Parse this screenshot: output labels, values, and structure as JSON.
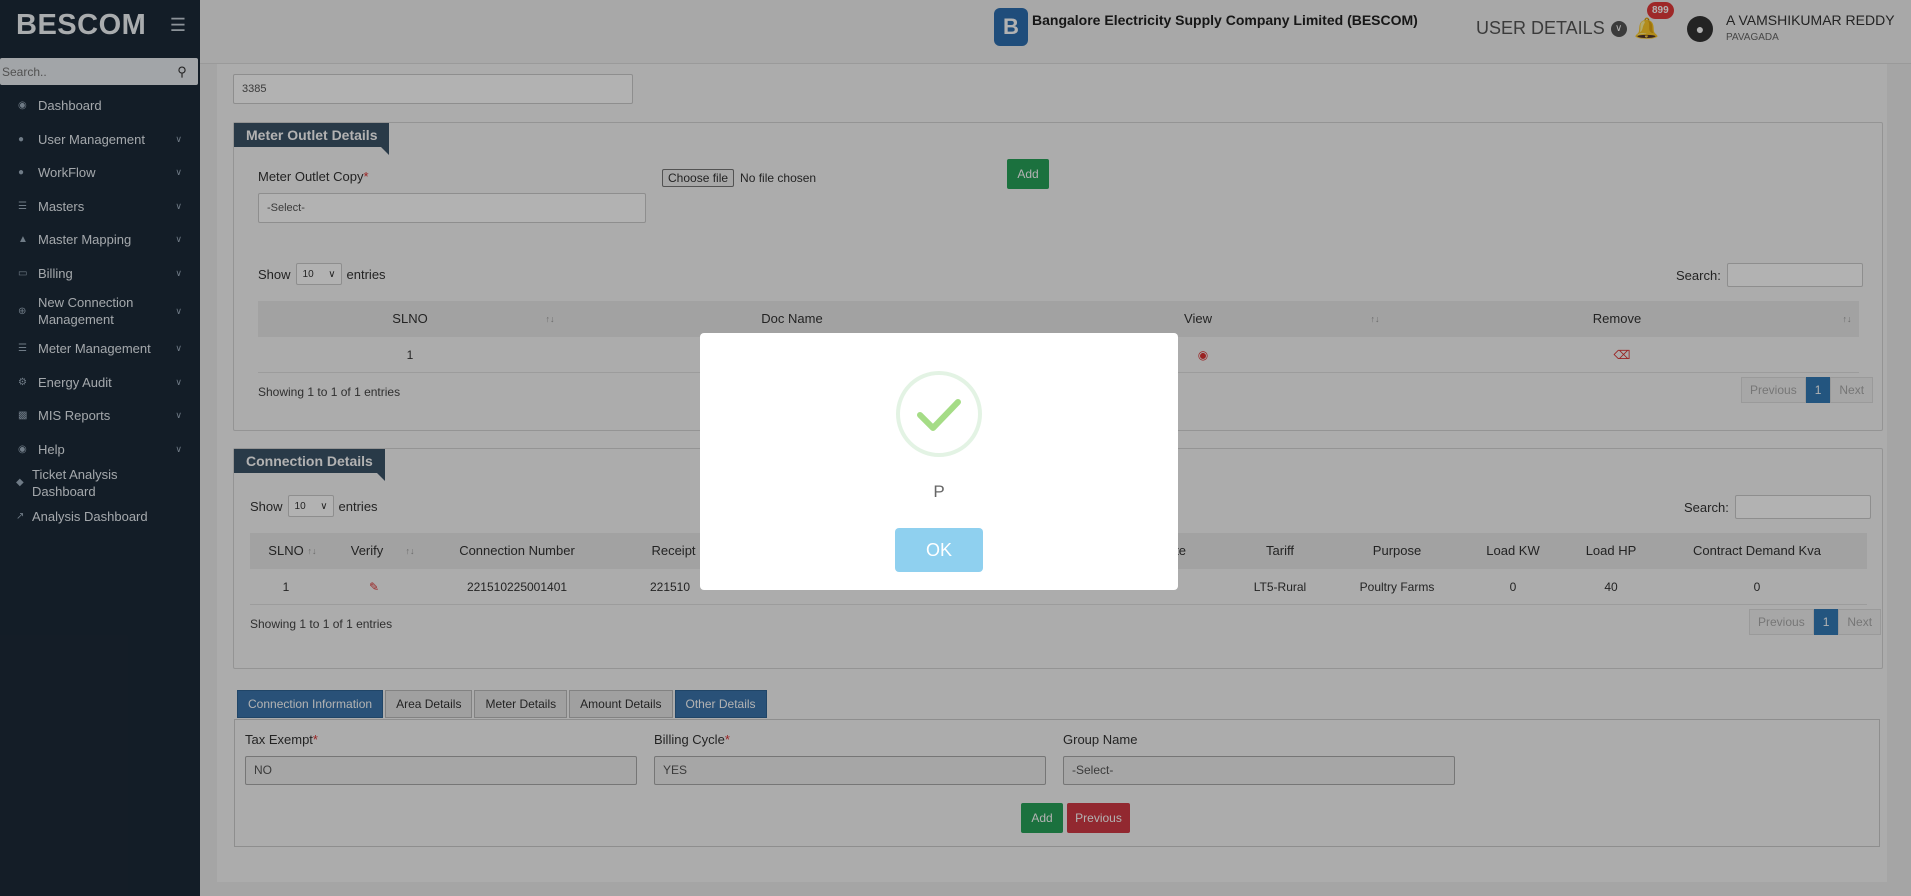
{
  "sidebar": {
    "brand": "BESCOM",
    "search_placeholder": "Search..",
    "items": [
      {
        "label": "Dashboard",
        "icon": "dashboard-icon"
      },
      {
        "label": "User Management",
        "icon": "user-icon"
      },
      {
        "label": "WorkFlow",
        "icon": "user-icon"
      },
      {
        "label": "Masters",
        "icon": "list-icon"
      },
      {
        "label": "Master Mapping",
        "icon": "sitemap-icon"
      },
      {
        "label": "Billing",
        "icon": "desktop-icon"
      },
      {
        "label": "New Connection Management",
        "icon": "plus-circle-icon"
      },
      {
        "label": "Meter Management",
        "icon": "list-icon"
      },
      {
        "label": "Energy Audit",
        "icon": "cogs-icon"
      },
      {
        "label": "MIS Reports",
        "icon": "bar-chart-icon"
      },
      {
        "label": "Help",
        "icon": "dashboard-icon"
      },
      {
        "label": "Ticket Analysis Dashboard",
        "icon": "tag-icon"
      },
      {
        "label": "Analysis Dashboard",
        "icon": "line-chart-icon"
      }
    ]
  },
  "header": {
    "logo_letter": "B",
    "company": "Bangalore Electricity Supply Company Limited (BESCOM)",
    "user_details": "USER DETAILS",
    "notification_count": "899",
    "user_name": "A VAMSHIKUMAR REDDY",
    "user_location": "PAVAGADA"
  },
  "main": {
    "top_input_value": "3385",
    "meter_outlet": {
      "title": "Meter Outlet Details",
      "copy_label": "Meter Outlet Copy",
      "copy_select": "-Select-",
      "choose_file": "Choose file",
      "no_file": "No file chosen",
      "add": "Add",
      "show": "Show",
      "entries_value": "10",
      "entries": "entries",
      "search": "Search:",
      "columns": [
        "SLNO",
        "Doc Name",
        "View",
        "Remove"
      ],
      "rows": [
        {
          "slno": "1"
        }
      ],
      "showing": "Showing 1 to 1 of 1 entries",
      "prev": "Previous",
      "page": "1",
      "next": "Next"
    },
    "connection": {
      "title": "Connection Details",
      "show": "Show",
      "entries_value": "10",
      "entries": "entries",
      "search": "Search:",
      "columns": [
        "SLNO",
        "Verify",
        "Connection Number",
        "Receipt N",
        "ate",
        "Tariff",
        "Purpose",
        "Load KW",
        "Load HP",
        "Contract Demand Kva"
      ],
      "row": {
        "slno": "1",
        "conn": "221510225001401",
        "receipt": "221510",
        "tariff": "LT5-Rural",
        "purpose": "Poultry Farms",
        "load_kw": "0",
        "load_hp": "40",
        "cd_kva": "0"
      },
      "showing": "Showing 1 to 1 of 1 entries",
      "prev": "Previous",
      "page": "1",
      "next": "Next"
    },
    "tabs": [
      "Connection Information",
      "Area Details",
      "Meter Details",
      "Amount Details",
      "Other Details"
    ],
    "other": {
      "tax_label": "Tax Exempt",
      "tax_value": "NO",
      "billing_label": "Billing Cycle",
      "billing_value": "YES",
      "group_label": "Group Name",
      "group_value": "-Select-",
      "add": "Add",
      "previous": "Previous"
    }
  },
  "modal": {
    "message": "P",
    "ok": "OK"
  }
}
